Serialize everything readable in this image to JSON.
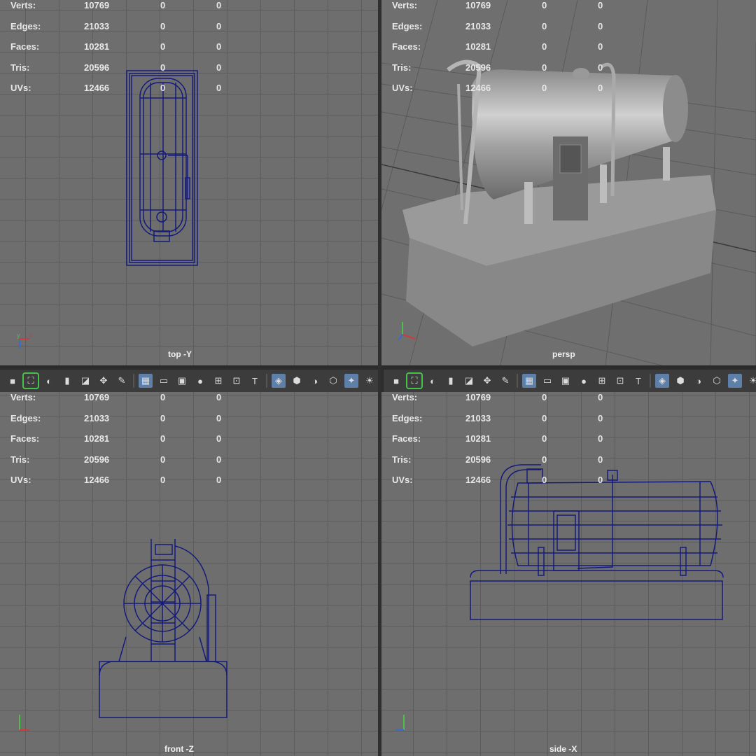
{
  "stats_labels": [
    "Verts:",
    "Edges:",
    "Faces:",
    "Tris:",
    "UVs:"
  ],
  "stats": [
    {
      "label": "Verts:",
      "v1": "10769",
      "v2": "0",
      "v3": "0"
    },
    {
      "label": "Edges:",
      "v1": "21033",
      "v2": "0",
      "v3": "0"
    },
    {
      "label": "Faces:",
      "v1": "10281",
      "v2": "0",
      "v3": "0"
    },
    {
      "label": "Tris:",
      "v1": "20596",
      "v2": "0",
      "v3": "0"
    },
    {
      "label": "UVs:",
      "v1": "12466",
      "v2": "0",
      "v3": "0"
    }
  ],
  "viewports": {
    "top": {
      "label": "top -Y"
    },
    "persp": {
      "label": "persp"
    },
    "front": {
      "label": "front -Z"
    },
    "side": {
      "label": "side -X"
    }
  },
  "toolbar_icons": [
    "camera-icon",
    "frame-selected-icon",
    "camera-attributes-icon",
    "bookmark-icon",
    "image-plane-icon",
    "two-d-pan-icon",
    "grease-pencil-icon",
    "grid-icon",
    "film-gate-icon",
    "resolution-gate-icon",
    "gate-mask-icon",
    "field-chart-icon",
    "safe-action-icon",
    "safe-title-icon",
    "wireframe-icon",
    "smooth-shade-icon",
    "default-material-icon",
    "wireframe-on-shaded-icon",
    "xray-icon",
    "lights-icon",
    "shadows-icon"
  ],
  "colors": {
    "wire": "#141a7a",
    "viewport": "#6e6e6e",
    "active_button": "#5d7fa8",
    "highlight": "#46c24b"
  }
}
